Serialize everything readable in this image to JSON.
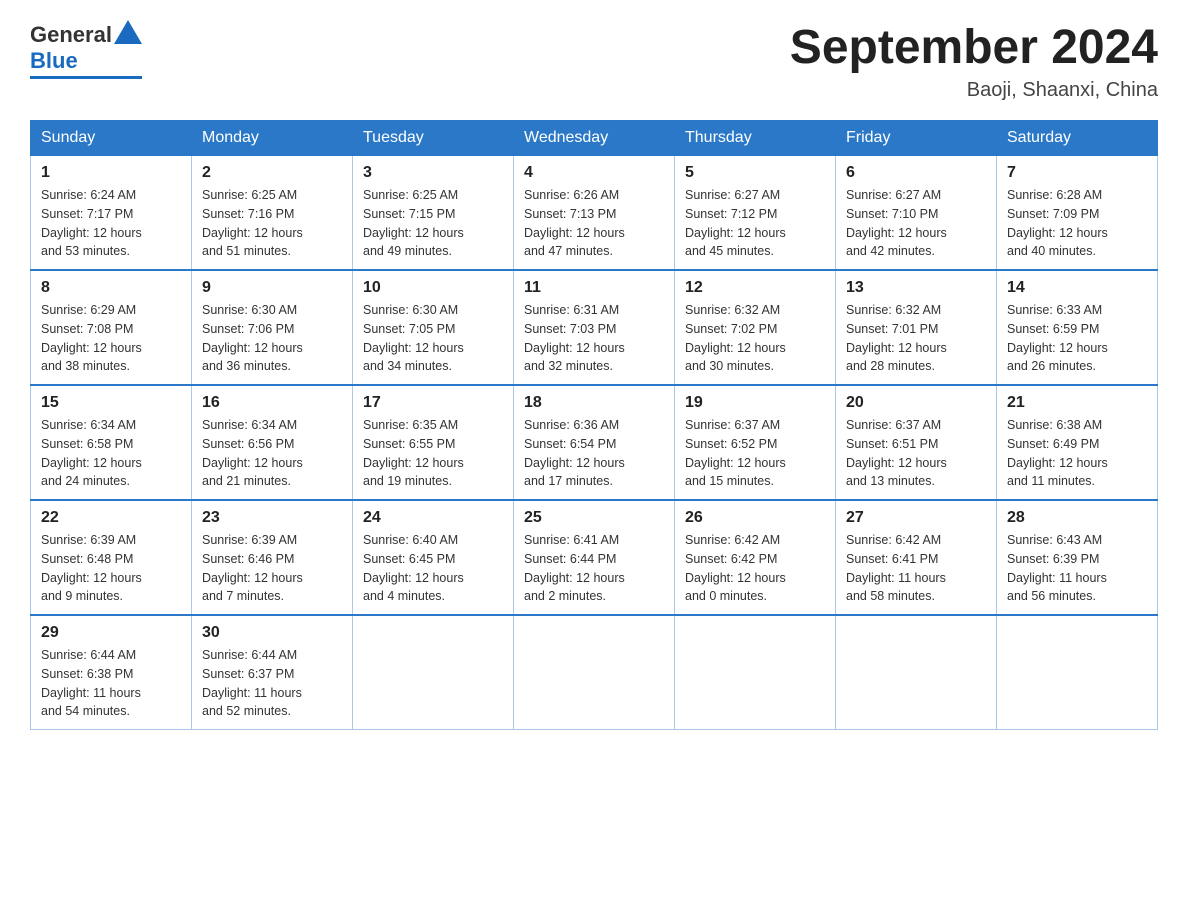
{
  "header": {
    "logo_general": "General",
    "logo_blue": "Blue",
    "main_title": "September 2024",
    "subtitle": "Baoji, Shaanxi, China"
  },
  "weekdays": [
    "Sunday",
    "Monday",
    "Tuesday",
    "Wednesday",
    "Thursday",
    "Friday",
    "Saturday"
  ],
  "weeks": [
    [
      {
        "day": "1",
        "sunrise": "6:24 AM",
        "sunset": "7:17 PM",
        "daylight": "12 hours and 53 minutes."
      },
      {
        "day": "2",
        "sunrise": "6:25 AM",
        "sunset": "7:16 PM",
        "daylight": "12 hours and 51 minutes."
      },
      {
        "day": "3",
        "sunrise": "6:25 AM",
        "sunset": "7:15 PM",
        "daylight": "12 hours and 49 minutes."
      },
      {
        "day": "4",
        "sunrise": "6:26 AM",
        "sunset": "7:13 PM",
        "daylight": "12 hours and 47 minutes."
      },
      {
        "day": "5",
        "sunrise": "6:27 AM",
        "sunset": "7:12 PM",
        "daylight": "12 hours and 45 minutes."
      },
      {
        "day": "6",
        "sunrise": "6:27 AM",
        "sunset": "7:10 PM",
        "daylight": "12 hours and 42 minutes."
      },
      {
        "day": "7",
        "sunrise": "6:28 AM",
        "sunset": "7:09 PM",
        "daylight": "12 hours and 40 minutes."
      }
    ],
    [
      {
        "day": "8",
        "sunrise": "6:29 AM",
        "sunset": "7:08 PM",
        "daylight": "12 hours and 38 minutes."
      },
      {
        "day": "9",
        "sunrise": "6:30 AM",
        "sunset": "7:06 PM",
        "daylight": "12 hours and 36 minutes."
      },
      {
        "day": "10",
        "sunrise": "6:30 AM",
        "sunset": "7:05 PM",
        "daylight": "12 hours and 34 minutes."
      },
      {
        "day": "11",
        "sunrise": "6:31 AM",
        "sunset": "7:03 PM",
        "daylight": "12 hours and 32 minutes."
      },
      {
        "day": "12",
        "sunrise": "6:32 AM",
        "sunset": "7:02 PM",
        "daylight": "12 hours and 30 minutes."
      },
      {
        "day": "13",
        "sunrise": "6:32 AM",
        "sunset": "7:01 PM",
        "daylight": "12 hours and 28 minutes."
      },
      {
        "day": "14",
        "sunrise": "6:33 AM",
        "sunset": "6:59 PM",
        "daylight": "12 hours and 26 minutes."
      }
    ],
    [
      {
        "day": "15",
        "sunrise": "6:34 AM",
        "sunset": "6:58 PM",
        "daylight": "12 hours and 24 minutes."
      },
      {
        "day": "16",
        "sunrise": "6:34 AM",
        "sunset": "6:56 PM",
        "daylight": "12 hours and 21 minutes."
      },
      {
        "day": "17",
        "sunrise": "6:35 AM",
        "sunset": "6:55 PM",
        "daylight": "12 hours and 19 minutes."
      },
      {
        "day": "18",
        "sunrise": "6:36 AM",
        "sunset": "6:54 PM",
        "daylight": "12 hours and 17 minutes."
      },
      {
        "day": "19",
        "sunrise": "6:37 AM",
        "sunset": "6:52 PM",
        "daylight": "12 hours and 15 minutes."
      },
      {
        "day": "20",
        "sunrise": "6:37 AM",
        "sunset": "6:51 PM",
        "daylight": "12 hours and 13 minutes."
      },
      {
        "day": "21",
        "sunrise": "6:38 AM",
        "sunset": "6:49 PM",
        "daylight": "12 hours and 11 minutes."
      }
    ],
    [
      {
        "day": "22",
        "sunrise": "6:39 AM",
        "sunset": "6:48 PM",
        "daylight": "12 hours and 9 minutes."
      },
      {
        "day": "23",
        "sunrise": "6:39 AM",
        "sunset": "6:46 PM",
        "daylight": "12 hours and 7 minutes."
      },
      {
        "day": "24",
        "sunrise": "6:40 AM",
        "sunset": "6:45 PM",
        "daylight": "12 hours and 4 minutes."
      },
      {
        "day": "25",
        "sunrise": "6:41 AM",
        "sunset": "6:44 PM",
        "daylight": "12 hours and 2 minutes."
      },
      {
        "day": "26",
        "sunrise": "6:42 AM",
        "sunset": "6:42 PM",
        "daylight": "12 hours and 0 minutes."
      },
      {
        "day": "27",
        "sunrise": "6:42 AM",
        "sunset": "6:41 PM",
        "daylight": "11 hours and 58 minutes."
      },
      {
        "day": "28",
        "sunrise": "6:43 AM",
        "sunset": "6:39 PM",
        "daylight": "11 hours and 56 minutes."
      }
    ],
    [
      {
        "day": "29",
        "sunrise": "6:44 AM",
        "sunset": "6:38 PM",
        "daylight": "11 hours and 54 minutes."
      },
      {
        "day": "30",
        "sunrise": "6:44 AM",
        "sunset": "6:37 PM",
        "daylight": "11 hours and 52 minutes."
      },
      null,
      null,
      null,
      null,
      null
    ]
  ]
}
